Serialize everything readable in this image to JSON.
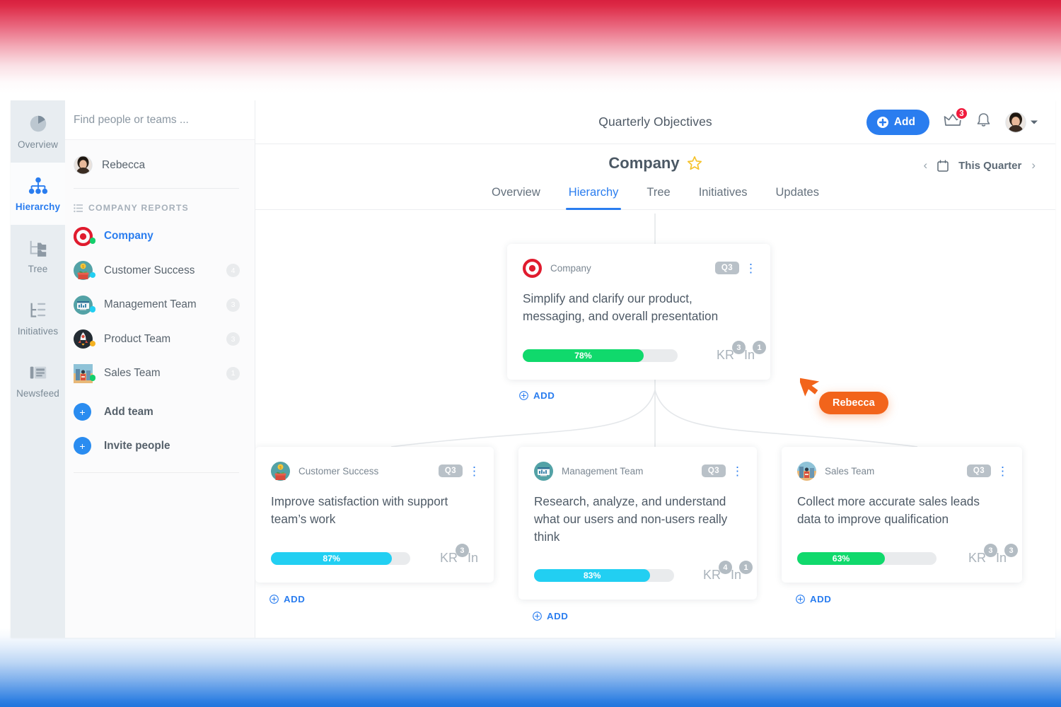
{
  "background": {
    "top_accent": "#d8203f",
    "bottom_accent": "#1f74dd"
  },
  "rail": {
    "items": [
      {
        "label": "Overview",
        "icon": "pie-chart-icon",
        "active": false
      },
      {
        "label": "Hierarchy",
        "icon": "hierarchy-icon",
        "active": true
      },
      {
        "label": "Tree",
        "icon": "tree-folder-icon",
        "active": false
      },
      {
        "label": "Initiatives",
        "icon": "initiatives-list-icon",
        "active": false
      },
      {
        "label": "Newsfeed",
        "icon": "newspaper-icon",
        "active": false
      }
    ]
  },
  "people_panel": {
    "search": {
      "placeholder": "Find people or teams ...",
      "value": ""
    },
    "me": {
      "name": "Rebecca"
    },
    "section_title": "COMPANY REPORTS",
    "teams": [
      {
        "name": "Company",
        "count": "",
        "status": "#13cf6b",
        "selected": true,
        "avatar": "target-icon"
      },
      {
        "name": "Customer Success",
        "count": "4",
        "status": "#22cff2",
        "selected": false,
        "avatar": "customer-success-avatar"
      },
      {
        "name": "Management Team",
        "count": "3",
        "status": "#22cff2",
        "selected": false,
        "avatar": "management-team-avatar"
      },
      {
        "name": "Product Team",
        "count": "3",
        "status": "#f5b221",
        "selected": false,
        "avatar": "product-team-avatar"
      },
      {
        "name": "Sales Team",
        "count": "1",
        "status": "#13cf6b",
        "selected": false,
        "avatar": "sales-team-avatar"
      }
    ],
    "actions": [
      {
        "label": "Add team",
        "icon": "plus-icon"
      },
      {
        "label": "Invite people",
        "icon": "plus-icon"
      }
    ]
  },
  "topbar": {
    "title": "Quarterly Objectives",
    "add_label": "Add",
    "crown_badge": "3",
    "icons": [
      "crown-icon",
      "bell-icon",
      "avatar",
      "chevron-down-icon"
    ]
  },
  "subbar": {
    "objective_title": "Company",
    "favorite_icon": "star-outline-icon",
    "quarter_label": "This Quarter",
    "prev_icon": "chevron-left-icon",
    "next_icon": "chevron-right-icon",
    "calendar_icon": "calendar-icon"
  },
  "tabs": [
    {
      "label": "Overview",
      "active": false
    },
    {
      "label": "Hierarchy",
      "active": true
    },
    {
      "label": "Tree",
      "active": false
    },
    {
      "label": "Initiatives",
      "active": false
    },
    {
      "label": "Updates",
      "active": false
    }
  ],
  "add_label": "ADD",
  "cards": [
    {
      "owner": "Company",
      "quarter": "Q3",
      "title": "Simplify and clarify our product, messaging, and overall presentation",
      "progress": "78%",
      "progress_value": 78,
      "progress_color": "#10d96c",
      "kr_label": "KR",
      "kr_count": "3",
      "in_label": "In",
      "in_count": "1",
      "avatar": "target-icon",
      "menu_icon": "kebab-menu-icon"
    },
    {
      "owner": "Customer Success",
      "quarter": "Q3",
      "title": "Improve satisfaction with support team’s work",
      "progress": "87%",
      "progress_value": 87,
      "progress_color": "#22cff2",
      "kr_label": "KR",
      "kr_count": "3",
      "in_label": "In",
      "in_count": "",
      "avatar": "customer-success-avatar",
      "menu_icon": "kebab-menu-icon"
    },
    {
      "owner": "Management Team",
      "quarter": "Q3",
      "title": "Research, analyze, and understand what our users and non-users really think",
      "progress": "83%",
      "progress_value": 83,
      "progress_color": "#22cff2",
      "kr_label": "KR",
      "kr_count": "4",
      "in_label": "In",
      "in_count": "1",
      "avatar": "management-team-avatar",
      "menu_icon": "kebab-menu-icon"
    },
    {
      "owner": "Sales Team",
      "quarter": "Q3",
      "title": "Collect more accurate sales leads data to improve qualification",
      "progress": "63%",
      "progress_value": 63,
      "progress_color": "#10d96c",
      "kr_label": "KR",
      "kr_count": "3",
      "in_label": "In",
      "in_count": "3",
      "avatar": "sales-team-avatar",
      "menu_icon": "kebab-menu-icon"
    }
  ],
  "remote_cursor": {
    "name": "Rebecca",
    "color": "#f2641b"
  }
}
